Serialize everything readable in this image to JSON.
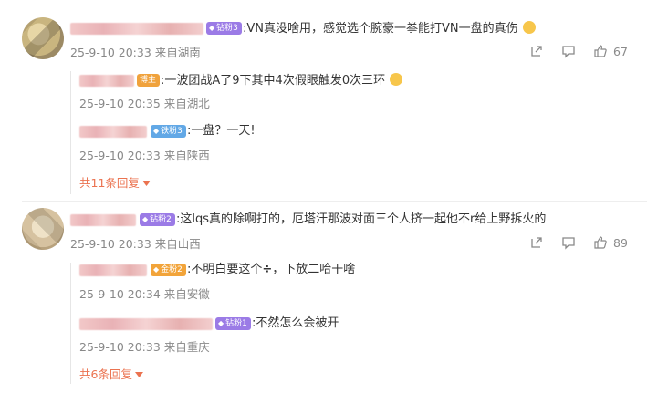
{
  "comments": [
    {
      "badge": "钻粉3",
      "badge_color": "#9b7be6",
      "text": ":VN真没啥用，感觉选个腕豪一拳能打VN一盘的真伤",
      "emoji": "cat-face",
      "time": "25-9-10 20:33",
      "location": "来自湖南",
      "likes": "67",
      "replies": [
        {
          "badge": "博主",
          "badge_color": "#f0a23c",
          "text": ":一波团战A了9下其中4次假眼触发0次三环",
          "emoji": "crying-face",
          "time": "25-9-10 20:35",
          "location": "来自湖北"
        },
        {
          "badge": "铁粉3",
          "badge_color": "#62a8e6",
          "text": ":一盘？一天!",
          "time": "25-9-10 20:33",
          "location": "来自陕西"
        }
      ],
      "more_label": "共11条回复"
    },
    {
      "badge": "钻粉2",
      "badge_color": "#9b7be6",
      "text": ":这lqs真的除啊打的，厄塔汗那波对面三个人挤一起他不r给上野拆火的",
      "time": "25-9-10 20:33",
      "location": "来自山西",
      "likes": "89",
      "replies": [
        {
          "badge": "金粉2",
          "badge_color": "#f2a43a",
          "text_before": ":不明白要这个",
          "text_after": "，下放二哈干啥",
          "symbol": "÷",
          "time": "25-9-10 20:34",
          "location": "来自安徽"
        },
        {
          "badge": "钻粉1",
          "badge_color": "#9b7be6",
          "text": ":不然怎么会被开",
          "time": "25-9-10 20:33",
          "location": "来自重庆"
        }
      ],
      "more_label": "共6条回复"
    }
  ],
  "icons": {
    "share": "share-icon",
    "comment": "comment-icon",
    "like": "thumbs-up-icon",
    "diamond": "diamond-icon",
    "expand": "caret-down-icon"
  }
}
